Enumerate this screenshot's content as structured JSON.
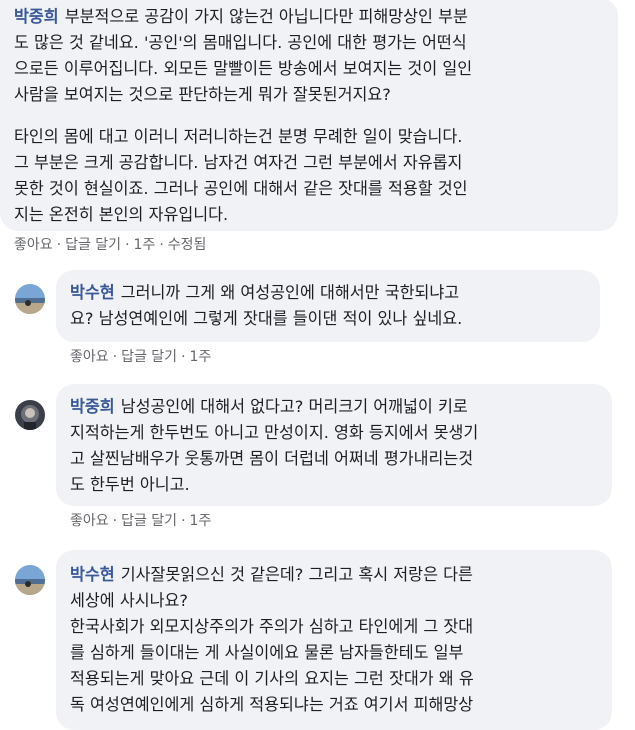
{
  "comments": [
    {
      "author": "박중희",
      "paragraphs": [
        [
          "부분적으로 공감이 가지 않는건 아닙니다만 피해망상인 부분",
          "도 많은 것 같네요. '공인'의 몸매입니다. 공인에 대한 평가는 어떤식",
          "으로든 이루어집니다. 외모든 말빨이든 방송에서 보여지는 것이 일인",
          "사람을 보여지는 것으로 판단하는게 뭐가 잘못된거지요?"
        ],
        [
          "타인의 몸에 대고 이러니 저러니하는건 분명 무례한 일이 맞습니다.",
          "그 부분은 크게 공감합니다. 남자건 여자건 그런 부분에서 자유롭지",
          "못한 것이 현실이죠. 그러나 공인에 대해서 같은 잣대를 적용할 것인",
          "지는 온전히 본인의 자유입니다."
        ]
      ],
      "actions": {
        "like": "좋아요",
        "reply": "답글 달기",
        "time": "1주",
        "edited": "수정됨"
      }
    },
    {
      "author": "박수현",
      "paragraphs": [
        [
          "그러니까 그게 왜 여성공인에 대해서만 국한되냐고",
          "요? 남성연예인에 그렇게 잣대를 들이댄 적이 있나 싶네요."
        ]
      ],
      "actions": {
        "like": "좋아요",
        "reply": "답글 달기",
        "time": "1주"
      }
    },
    {
      "author": "박중희",
      "paragraphs": [
        [
          "남성공인에 대해서 없다고? 머리크기 어깨넓이 키로",
          "지적하는게 한두번도 아니고 만성이지. 영화 등지에서 못생기",
          "고 살찐남배우가 웃통까면 몸이 더럽네 어쩌네 평가내리는것",
          "도 한두번 아니고."
        ]
      ],
      "actions": {
        "like": "좋아요",
        "reply": "답글 달기",
        "time": "1주"
      }
    },
    {
      "author": "박수현",
      "paragraphs": [
        [
          "기사잘못읽으신 것 같은데? 그리고 혹시 저랑은 다른",
          "세상에 사시나요?",
          "한국사회가 외모지상주의가 주의가 심하고 타인에게 그 잣대",
          "를 심하게 들이대는 게 사실이에요 물론 남자들한테도 일부",
          "적용되는게 맞아요 근데 이 기사의 요지는 그런 잣대가 왜 유",
          "독 여성연예인에게 심하게 적용되냐는 거죠 여기서 피해망상"
        ]
      ]
    }
  ],
  "colors": {
    "bubble": "#f0f2f5",
    "author": "#385898",
    "meta": "#65676b",
    "text": "#1c1e21"
  },
  "icons": {
    "avatar_1": "avatar-sky-icon",
    "avatar_2": "avatar-dark-icon"
  }
}
